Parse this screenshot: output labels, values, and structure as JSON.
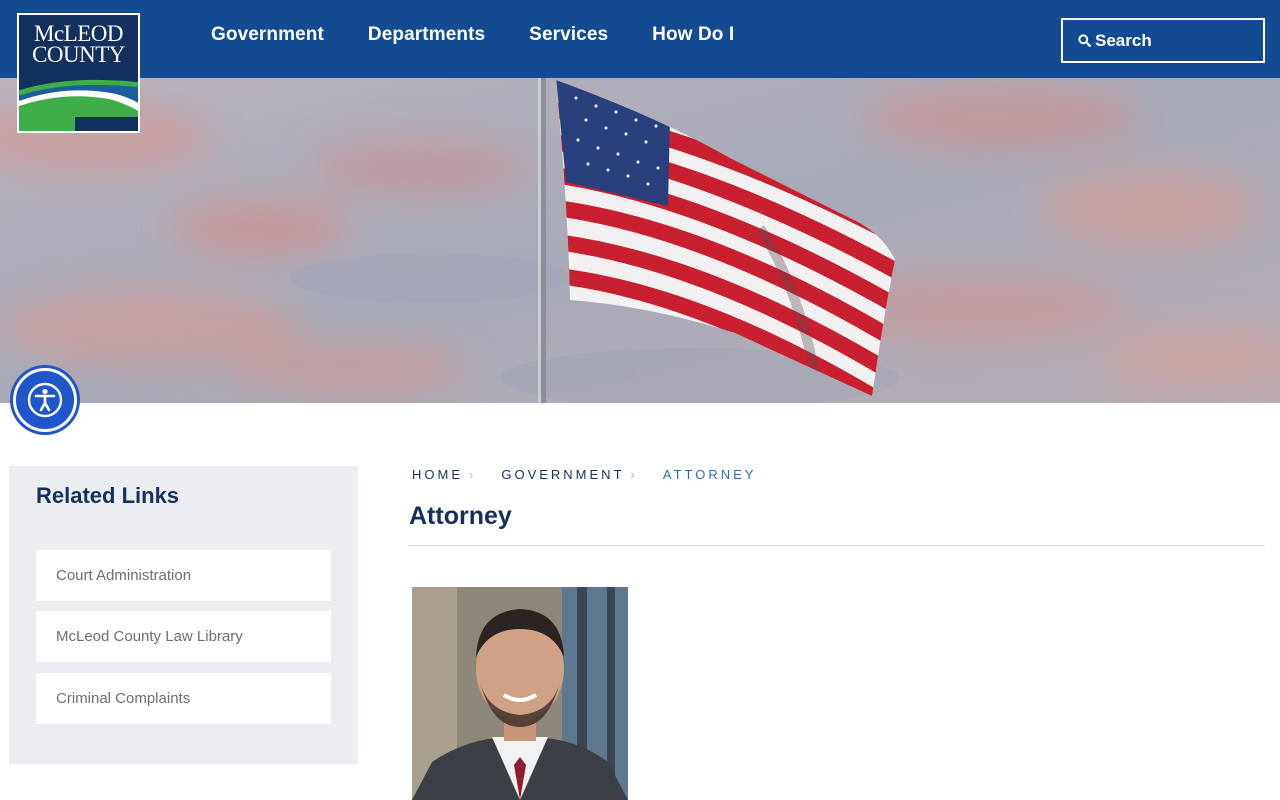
{
  "header": {
    "logo": {
      "line1": "McLEOD",
      "line2": "COUNTY"
    },
    "nav": [
      "Government",
      "Departments",
      "Services",
      "How Do I"
    ],
    "search_label": "Search"
  },
  "sidebar": {
    "title": "Related Links",
    "links": [
      "Court Administration",
      "McLeod County Law Library",
      "Criminal Complaints"
    ]
  },
  "breadcrumb": [
    "HOME",
    "GOVERNMENT",
    "ATTORNEY"
  ],
  "page_title": "Attorney",
  "colors": {
    "header_bg": "#134b93",
    "logo_bg": "#12315e",
    "heading": "#12315e",
    "breadcrumb_current": "#2b6db0",
    "sidebar_bg": "#eceef2",
    "accessibility_button": "#1f56c9"
  }
}
